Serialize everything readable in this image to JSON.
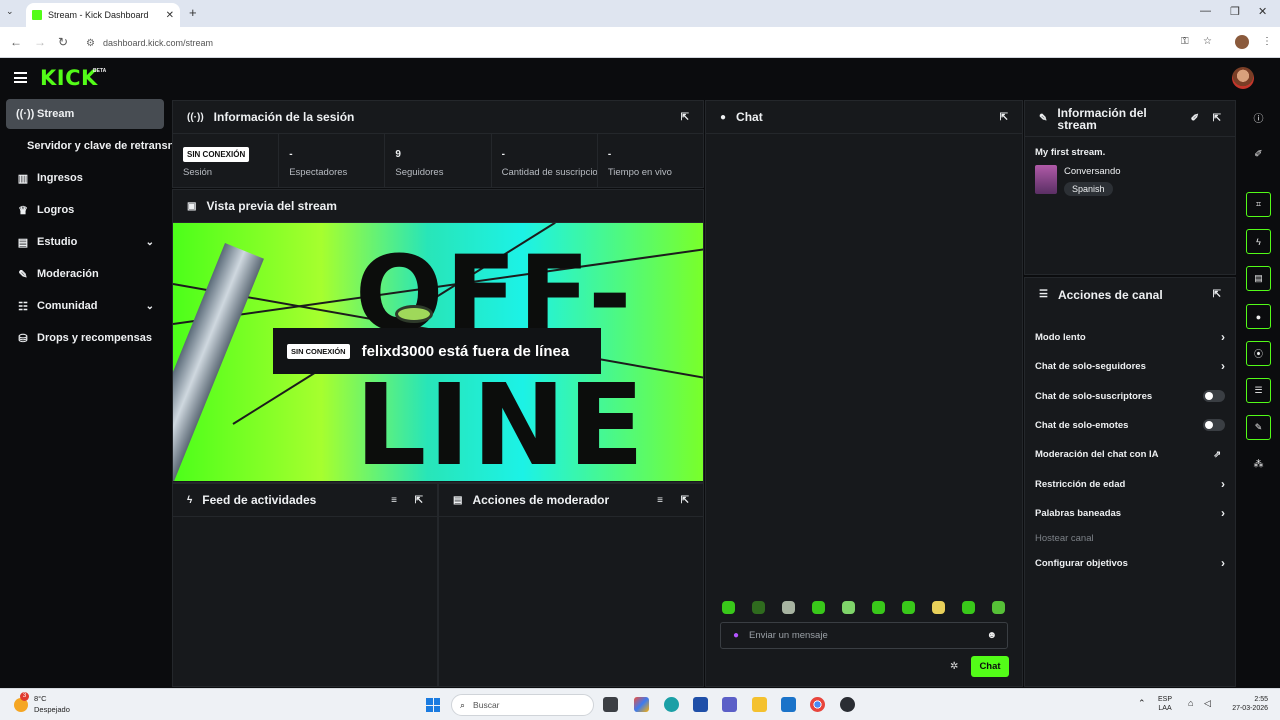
{
  "browser": {
    "tab_title": "Stream - Kick Dashboard",
    "url": "dashboard.kick.com/stream"
  },
  "brand": {
    "logo": "KICK",
    "beta": "BETA",
    "accent": "#53fc18"
  },
  "sidebar": {
    "items": [
      {
        "label": "Stream",
        "icon": "broadcast-icon"
      },
      {
        "label": "Servidor y clave de retransn",
        "icon": ""
      },
      {
        "label": "Ingresos",
        "icon": "chart-icon"
      },
      {
        "label": "Logros",
        "icon": "trophy-icon"
      },
      {
        "label": "Estudio",
        "icon": "studio-icon"
      },
      {
        "label": "Moderación",
        "icon": "wrench-icon"
      },
      {
        "label": "Comunidad",
        "icon": "community-icon"
      },
      {
        "label": "Drops y recompensas",
        "icon": "drops-icon"
      }
    ]
  },
  "session": {
    "title": "Información de la sesión",
    "status_badge": "SIN CONEXIÓN",
    "stats": [
      {
        "value": "",
        "label": "Sesión"
      },
      {
        "value": "-",
        "label": "Espectadores"
      },
      {
        "value": "9",
        "label": "Seguidores"
      },
      {
        "value": "-",
        "label": "Cantidad de suscripciones"
      },
      {
        "value": "-",
        "label": "Tiempo en vivo"
      }
    ]
  },
  "preview": {
    "title": "Vista previa del stream",
    "offline_badge": "SIN CONEXIÓN",
    "offline_message": "felixd3000 está fuera de línea",
    "art_line1": "OFF-",
    "art_line2": "LINE"
  },
  "activity_feed": {
    "title": "Feed de actividades"
  },
  "mod_actions": {
    "title": "Acciones de moderador"
  },
  "chat": {
    "title": "Chat",
    "input_placeholder": "Enviar un mensaje",
    "send_label": "Chat"
  },
  "stream_info": {
    "title": "Información del stream",
    "stream_title": "My first stream.",
    "category": "Conversando",
    "language": "Spanish"
  },
  "channel_actions": {
    "title": "Acciones de canal",
    "items": [
      {
        "label": "Modo lento",
        "control": "chevron"
      },
      {
        "label": "Chat de solo-seguidores",
        "control": "chevron"
      },
      {
        "label": "Chat de solo-suscriptores",
        "control": "toggle"
      },
      {
        "label": "Chat de solo-emotes",
        "control": "toggle"
      },
      {
        "label": "Moderación del chat con IA",
        "control": "external"
      },
      {
        "label": "Restricción de edad",
        "control": "chevron"
      },
      {
        "label": "Palabras baneadas",
        "control": "chevron"
      },
      {
        "label": "Hostear canal",
        "control": "disabled"
      },
      {
        "label": "Configurar objetivos",
        "control": "chevron"
      }
    ]
  },
  "taskbar": {
    "weather_temp": "8°C",
    "weather_desc": "Despejado",
    "weather_badge": "3",
    "search_placeholder": "Buscar",
    "lang_line1": "ESP",
    "lang_line2": "LAA",
    "time": "2:55",
    "date": "27-03-2026"
  }
}
